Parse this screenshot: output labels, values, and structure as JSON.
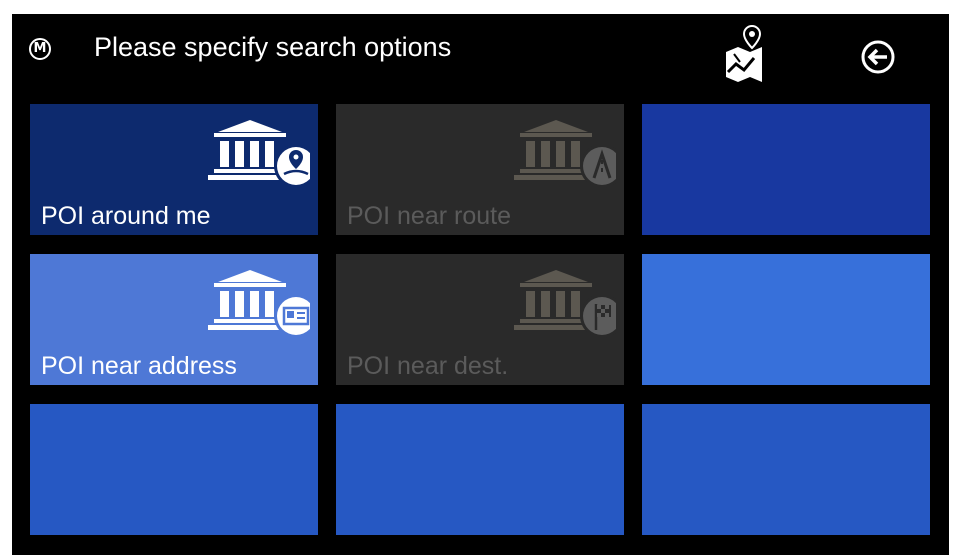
{
  "header": {
    "menu_badge": "M",
    "title": "Please specify search options",
    "map_icon": "map-route-icon",
    "back_icon": "back-arrow-icon"
  },
  "tiles": [
    {
      "label": "POI around me",
      "state": "selected",
      "icon": "poi-around-me-icon",
      "color": "#0d2a6e"
    },
    {
      "label": "POI near route",
      "state": "disabled",
      "icon": "poi-near-route-icon",
      "color": "#2a2a2a"
    },
    {
      "label": "",
      "state": "empty",
      "icon": "",
      "color": "#1838a0"
    },
    {
      "label": "POI near address",
      "state": "enabled",
      "icon": "poi-near-address-icon",
      "color": "#4e78d6"
    },
    {
      "label": "POI near dest.",
      "state": "disabled",
      "icon": "poi-near-destination-icon",
      "color": "#2a2a2a"
    },
    {
      "label": "",
      "state": "empty",
      "icon": "",
      "color": "#3770da"
    },
    {
      "label": "",
      "state": "empty",
      "icon": "",
      "color": "#2658c3"
    },
    {
      "label": "",
      "state": "empty",
      "icon": "",
      "color": "#2658c3"
    },
    {
      "label": "",
      "state": "empty",
      "icon": "",
      "color": "#2658c3"
    }
  ]
}
